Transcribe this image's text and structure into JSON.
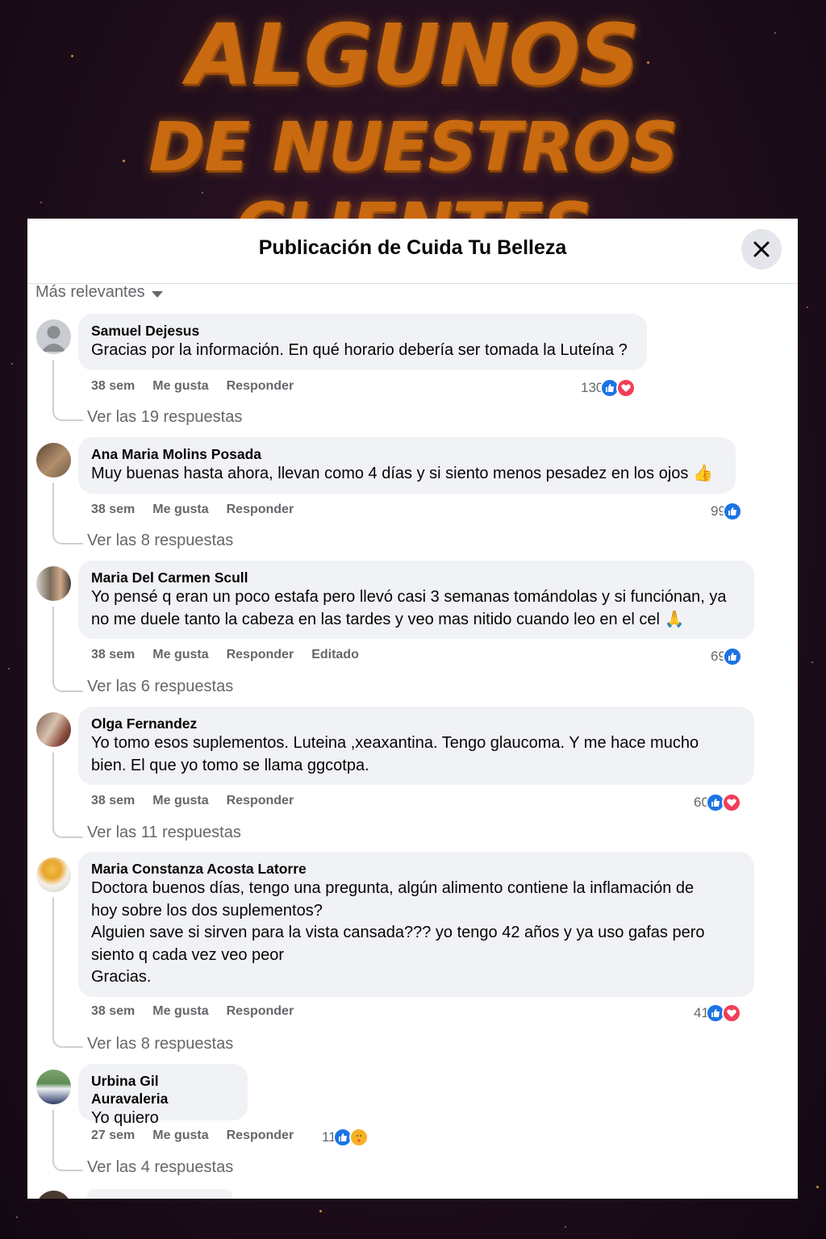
{
  "headline": {
    "line1": "ALGUNOS",
    "line2": "DE NUESTROS CLIENTES"
  },
  "dialog": {
    "title": "Publicación de Cuida Tu Belleza",
    "sort_label": "Más relevantes"
  },
  "actions": {
    "like": "Me gusta",
    "reply": "Responder",
    "edited": "Editado"
  },
  "comments": [
    {
      "author": "Samuel Dejesus",
      "text": "Gracias por la información. En qué horario debería ser tomada la Luteína ?",
      "time": "38 sem",
      "count": "130",
      "reactions": [
        "like-icon",
        "love-icon"
      ],
      "replies": "Ver las 19 respuestas"
    },
    {
      "author": "Ana Maria Molins Posada",
      "text": "Muy buenas hasta ahora, llevan como 4 días y si siento menos pesadez en los ojos 👍",
      "time": "38 sem",
      "count": "99",
      "reactions": [
        "like-icon"
      ],
      "replies": "Ver las 8 respuestas"
    },
    {
      "author": "Maria Del Carmen Scull",
      "text": "Yo pensé q eran un poco estafa pero llevó casi 3 semanas tomándolas y si funciónan, ya\nno me duele tanto la cabeza en las tardes y veo mas nitido cuando leo en el cel 🙏",
      "time": "38 sem",
      "count": "69",
      "reactions": [
        "like-icon"
      ],
      "replies": "Ver las 6 respuestas"
    },
    {
      "author": "Olga Fernandez",
      "text": "Yo tomo esos suplementos. Luteina ,xeaxantina. Tengo glaucoma. Y me hace mucho\nbien. El que yo tomo se llama ggcotpa.",
      "time": "38 sem",
      "count": "60",
      "reactions": [
        "like-icon",
        "love-icon"
      ],
      "replies": "Ver las 11 respuestas"
    },
    {
      "author": "Maria Constanza Acosta Latorre",
      "text": "Doctora buenos días, tengo una pregunta, algún alimento contiene la inflamación de\nhoy sobre los dos suplementos?\nAlguien save si sirven para la vista cansada??? yo tengo 42 años y ya uso gafas pero\nsiento q cada vez veo peor\nGracias.",
      "time": "38 sem",
      "count": "41",
      "reactions": [
        "like-icon",
        "love-icon"
      ],
      "replies": "Ver las 8 respuestas"
    },
    {
      "author": "Urbina Gil Auravaleria",
      "text": "Yo quiero",
      "time": "27 sem",
      "count": "11",
      "reactions": [
        "like-icon",
        "care-icon"
      ],
      "replies": "Ver las 4 respuestas"
    }
  ]
}
